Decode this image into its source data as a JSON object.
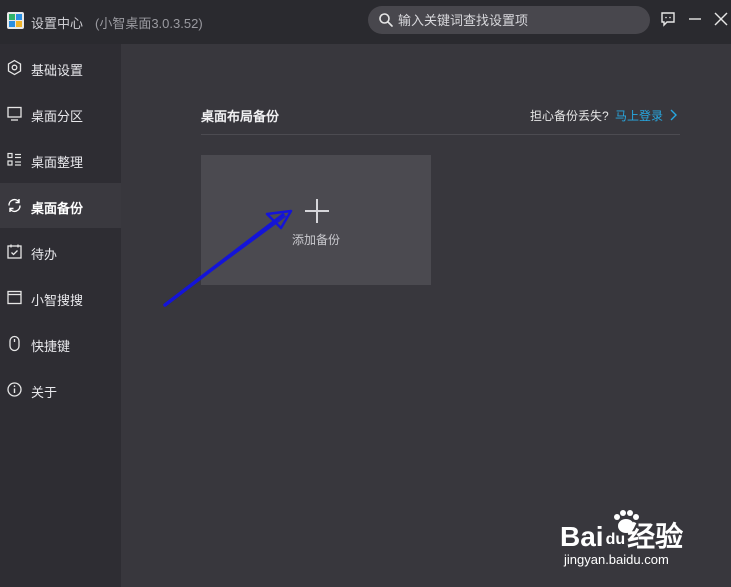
{
  "window": {
    "title": "设置中心",
    "version": "(小智桌面3.0.3.52)"
  },
  "search": {
    "placeholder": "输入关键词查找设置项"
  },
  "sidebar": {
    "items": [
      {
        "label": "基础设置",
        "icon": "hexagon-settings-icon",
        "active": false
      },
      {
        "label": "桌面分区",
        "icon": "monitor-icon",
        "active": false
      },
      {
        "label": "桌面整理",
        "icon": "list-organize-icon",
        "active": false
      },
      {
        "label": "桌面备份",
        "icon": "backup-sync-icon",
        "active": true
      },
      {
        "label": "待办",
        "icon": "calendar-check-icon",
        "active": false
      },
      {
        "label": "小智搜搜",
        "icon": "window-search-icon",
        "active": false
      },
      {
        "label": "快捷键",
        "icon": "mouse-icon",
        "active": false
      },
      {
        "label": "关于",
        "icon": "info-icon",
        "active": false
      }
    ]
  },
  "main": {
    "section_title": "桌面布局备份",
    "login_hint": "担心备份丢失?",
    "login_link": "马上登录",
    "add_backup_label": "添加备份"
  },
  "watermark": {
    "brand_left": "Bai",
    "brand_right": "经验",
    "brand_mid": "du",
    "url": "jingyan.baidu.com"
  },
  "colors": {
    "accent": "#27a7e0",
    "annotation_arrow": "#1414d8",
    "background": "#38373d",
    "sidebar": "#2e2d33",
    "titlebar": "#2a2a2f"
  }
}
